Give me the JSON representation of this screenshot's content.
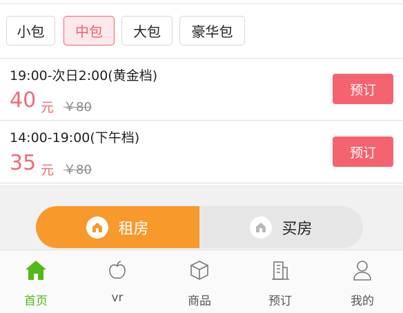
{
  "room_types": [
    "小包",
    "中包",
    "大包",
    "豪华包"
  ],
  "selected_room": "中包",
  "slots": [
    {
      "time": "19:00-次日2:00(黄金档)",
      "price": "40",
      "unit": "元",
      "original": "￥80",
      "button": "预订"
    },
    {
      "time": "14:00-19:00(下午档)",
      "price": "35",
      "unit": "元",
      "original": "￥80",
      "button": "预订"
    }
  ],
  "switch": {
    "rent_label": "租房",
    "buy_label": "买房",
    "active": "租房"
  },
  "tabbar": {
    "items": [
      {
        "label": "首页",
        "icon": "home-icon",
        "active": true
      },
      {
        "label": "vr",
        "icon": "apple-icon",
        "active": false
      },
      {
        "label": "商品",
        "icon": "box-icon",
        "active": false
      },
      {
        "label": "预订",
        "icon": "building-icon",
        "active": false
      },
      {
        "label": "我的",
        "icon": "user-icon",
        "active": false
      }
    ]
  },
  "colors": {
    "accent_pink": "#f4636f",
    "accent_orange": "#f79a2b",
    "active_green": "#52b91b"
  }
}
